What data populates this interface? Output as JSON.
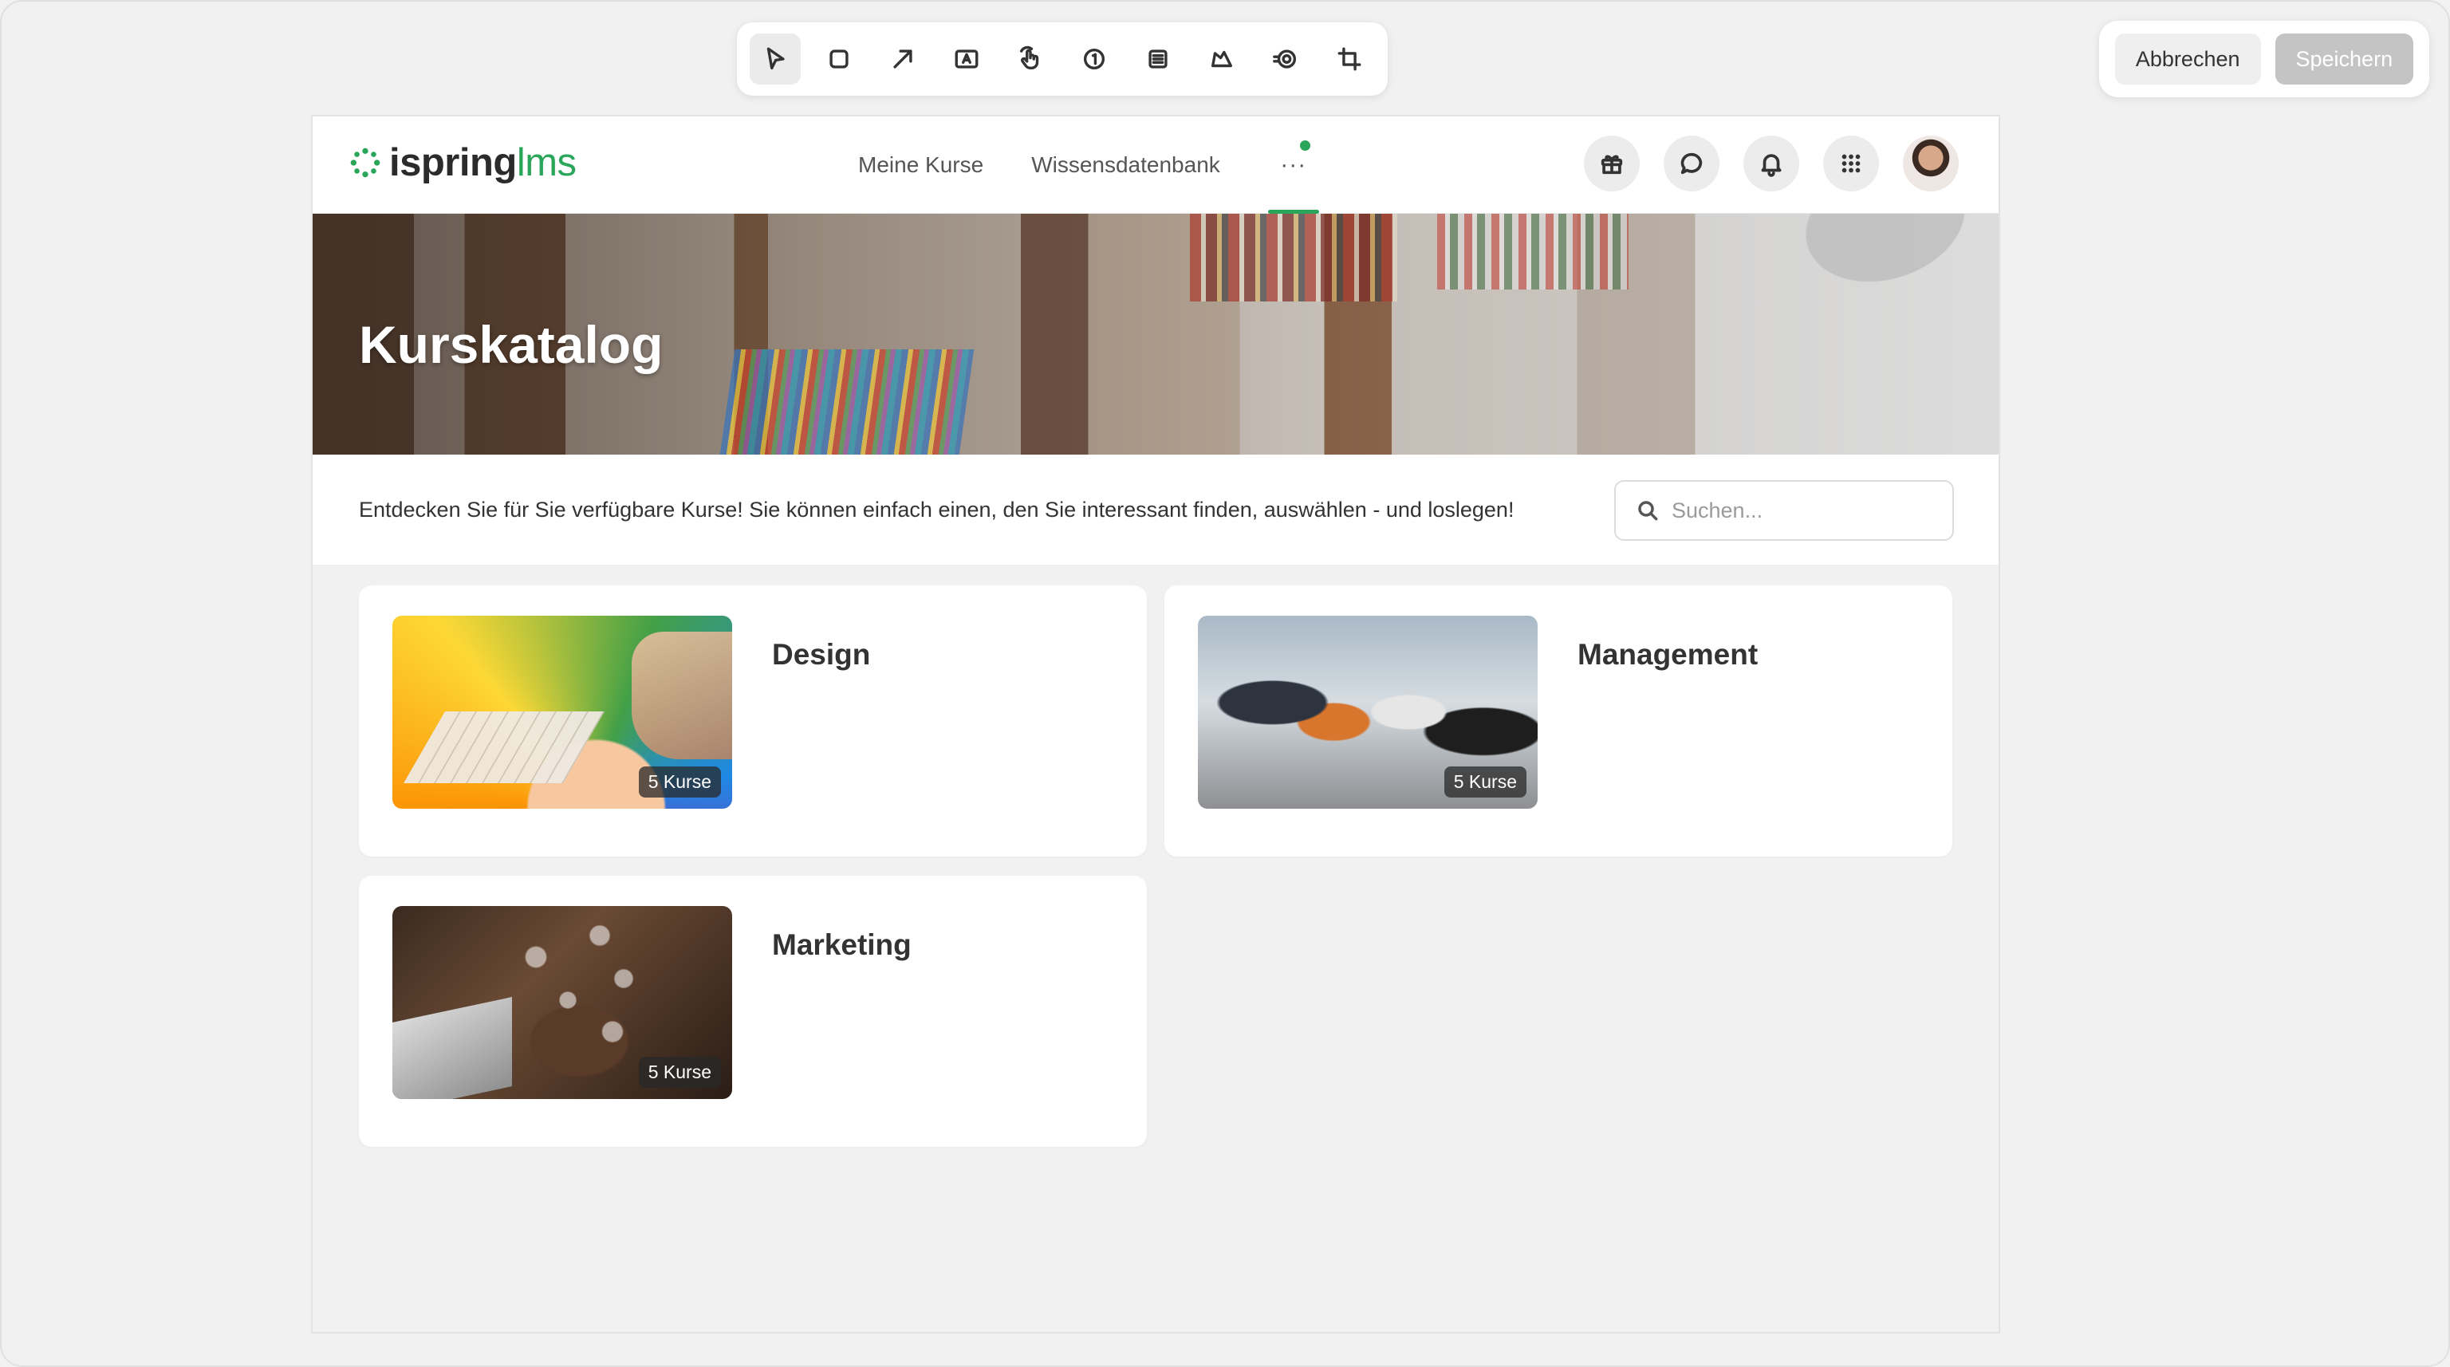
{
  "editor": {
    "tools": [
      {
        "name": "pointer-tool-icon",
        "active": true
      },
      {
        "name": "rectangle-tool-icon",
        "active": false
      },
      {
        "name": "arrow-tool-icon",
        "active": false
      },
      {
        "name": "text-box-tool-icon",
        "active": false
      },
      {
        "name": "click-tool-icon",
        "active": false
      },
      {
        "name": "step-number-tool-icon",
        "active": false
      },
      {
        "name": "blur-tool-icon",
        "active": false
      },
      {
        "name": "highlight-tool-icon",
        "active": false
      },
      {
        "name": "spotlight-tool-icon",
        "active": false
      },
      {
        "name": "crop-tool-icon",
        "active": false
      }
    ],
    "cancel_label": "Abbrechen",
    "save_label": "Speichern"
  },
  "header": {
    "logo_main": "ispring",
    "logo_accent": "lms",
    "nav": [
      "Meine Kurse",
      "Wissensdatenbank"
    ],
    "more_label": "···",
    "icons": [
      "gift-icon",
      "chat-icon",
      "bell-icon",
      "apps-grid-icon"
    ],
    "accent_color": "#2aa55a"
  },
  "hero": {
    "title": "Kurskatalog"
  },
  "intro": {
    "text": "Entdecken Sie für Sie verfügbare Kurse! Sie können einfach einen, den Sie interessant finden, auswählen - und loslegen!",
    "search_placeholder": "Suchen..."
  },
  "categories": [
    {
      "title": "Design",
      "count_label": "5 Kurse"
    },
    {
      "title": "Management",
      "count_label": "5 Kurse"
    },
    {
      "title": "Marketing",
      "count_label": "5 Kurse"
    }
  ]
}
